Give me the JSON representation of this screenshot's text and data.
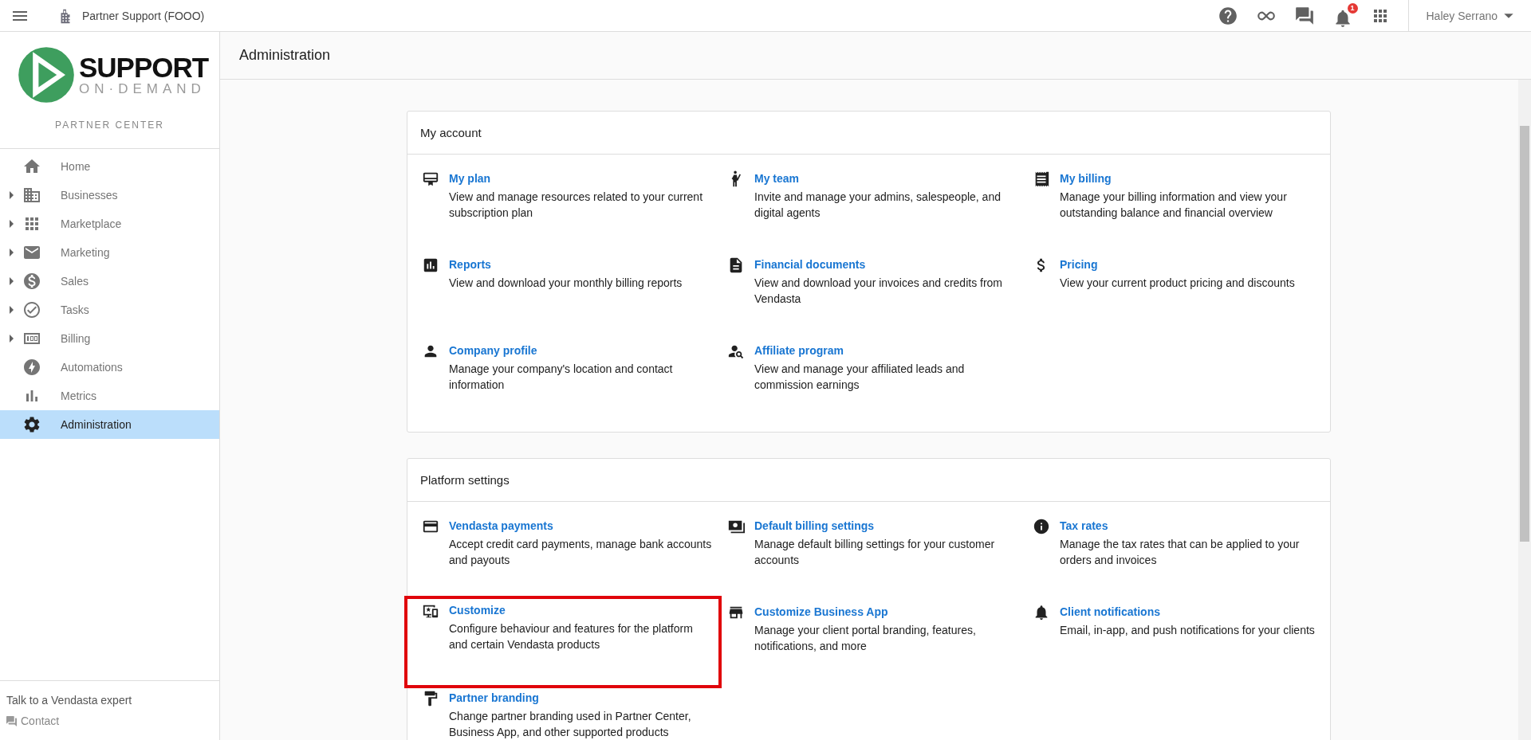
{
  "topbar": {
    "account": "Partner Support (FOOO)",
    "notification_count": "1",
    "user": "Haley Serrano"
  },
  "sidebar": {
    "logo": {
      "main": "SUPPORT",
      "sub": "ON·DEMAND"
    },
    "subtitle": "PARTNER CENTER",
    "items": [
      {
        "label": "Home",
        "expandable": false,
        "selected": false
      },
      {
        "label": "Businesses",
        "expandable": true,
        "selected": false
      },
      {
        "label": "Marketplace",
        "expandable": true,
        "selected": false
      },
      {
        "label": "Marketing",
        "expandable": true,
        "selected": false
      },
      {
        "label": "Sales",
        "expandable": true,
        "selected": false
      },
      {
        "label": "Tasks",
        "expandable": true,
        "selected": false
      },
      {
        "label": "Billing",
        "expandable": true,
        "selected": false
      },
      {
        "label": "Automations",
        "expandable": false,
        "selected": false
      },
      {
        "label": "Metrics",
        "expandable": false,
        "selected": false
      },
      {
        "label": "Administration",
        "expandable": false,
        "selected": true
      }
    ],
    "footer": {
      "text": "Talk to a Vendasta expert",
      "link": "Contact"
    }
  },
  "page": {
    "title": "Administration",
    "sections": [
      {
        "title": "My account",
        "items": [
          {
            "title": "My plan",
            "description": "View and manage resources related to your current subscription plan",
            "highlighted": false
          },
          {
            "title": "My team",
            "description": "Invite and manage your admins, salespeople, and digital agents",
            "highlighted": false
          },
          {
            "title": "My billing",
            "description": "Manage your billing information and view your outstanding balance and financial overview",
            "highlighted": false
          },
          {
            "title": "Reports",
            "description": "View and download your monthly billing reports",
            "highlighted": false
          },
          {
            "title": "Financial documents",
            "description": "View and download your invoices and credits from Vendasta",
            "highlighted": false
          },
          {
            "title": "Pricing",
            "description": "View your current product pricing and discounts",
            "highlighted": false
          },
          {
            "title": "Company profile",
            "description": "Manage your company's location and contact information",
            "highlighted": false
          },
          {
            "title": "Affiliate program",
            "description": "View and manage your affiliated leads and commission earnings",
            "highlighted": false
          }
        ]
      },
      {
        "title": "Platform settings",
        "items": [
          {
            "title": "Vendasta payments",
            "description": "Accept credit card payments, manage bank accounts and payouts",
            "highlighted": false
          },
          {
            "title": "Default billing settings",
            "description": "Manage default billing settings for your customer accounts",
            "highlighted": false
          },
          {
            "title": "Tax rates",
            "description": "Manage the tax rates that can be applied to your orders and invoices",
            "highlighted": false
          },
          {
            "title": "Customize",
            "description": "Configure behaviour and features for the platform and certain Vendasta products",
            "highlighted": true
          },
          {
            "title": "Customize Business App",
            "description": "Manage your client portal branding, features, notifications, and more",
            "highlighted": false
          },
          {
            "title": "Client notifications",
            "description": "Email, in-app, and push notifications for your clients",
            "highlighted": false
          },
          {
            "title": "Partner branding",
            "description": "Change partner branding used in Partner Center, Business App, and other supported products",
            "highlighted": false
          }
        ]
      }
    ]
  }
}
